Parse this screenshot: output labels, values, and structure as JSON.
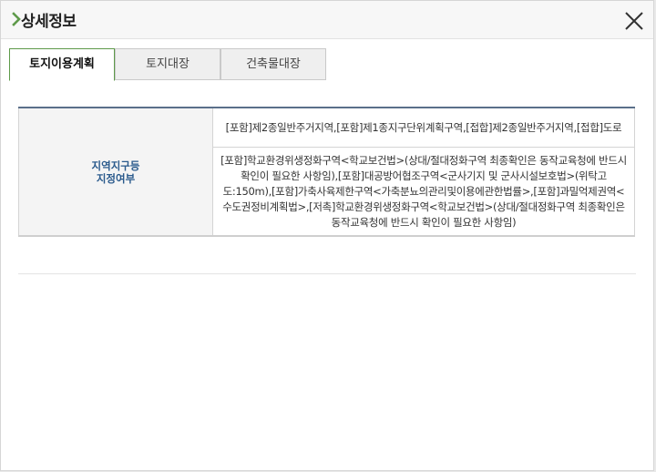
{
  "dialog": {
    "title": "상세정보"
  },
  "tabs": [
    {
      "label": "토지이용계획",
      "active": true
    },
    {
      "label": "토지대장",
      "active": false
    },
    {
      "label": "건축물대장",
      "active": false
    }
  ],
  "land_use": {
    "label_line1": "지역지구등",
    "label_line2": "지정여부",
    "row1": "[포함]제2종일반주거지역,[포함]제1종지구단위계획구역,[접합]제2종일반주거지역,[접합]도로",
    "row2": "[포함]학교환경위생정화구역<학교보건법>(상대/절대정화구역 최종확인은 동작교육청에 반드시 확인이 필요한 사항임),[포함]대공방어협조구역<군사기지 및 군사시설보호법>(위탁고도:150m),[포함]가축사육제한구역<가축분뇨의관리및이용에관한법률>,[포함]과밀억제권역<수도권정비계획법>,[저촉]학교환경위생정화구역<학교보건법>(상대/절대정화구역 최종확인은 동작교육청에 반드시 확인이 필요한 사항임)"
  },
  "colors": {
    "accent_green": "#5e9a4a",
    "label_blue": "#2a5a8c"
  }
}
